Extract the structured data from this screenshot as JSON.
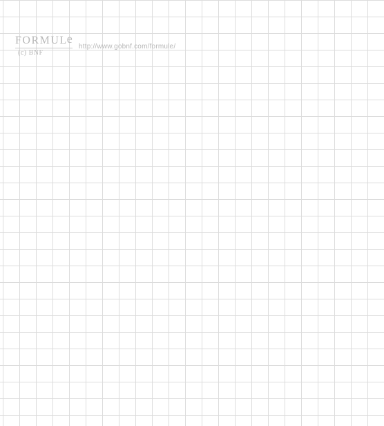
{
  "logo": {
    "main": "FORMUL",
    "sup": "e",
    "sub": "(c) BNF"
  },
  "url": "http://www.gobnf.com/formule/"
}
